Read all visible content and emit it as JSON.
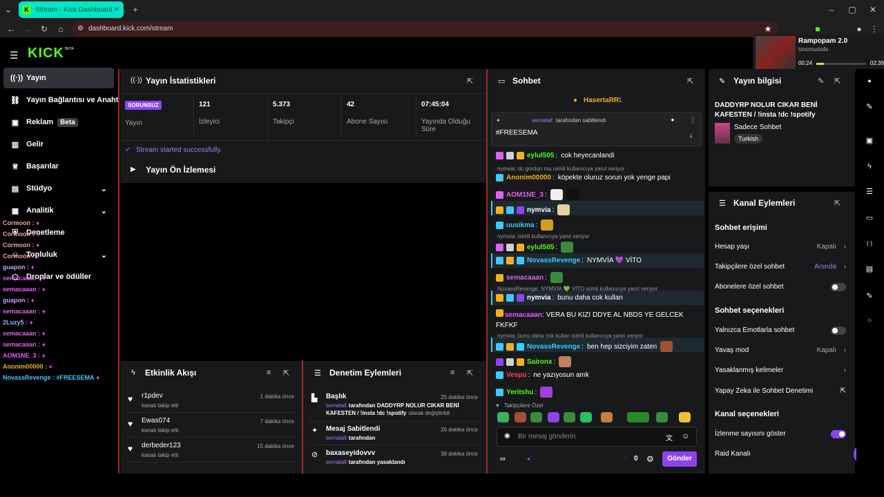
{
  "browser": {
    "tab_title": "Stream - Kick Dashboard",
    "url": "dashboard.kick.com/stream"
  },
  "media_popup": {
    "title": "Rampopam 2.0",
    "artist": "tzocmustafa",
    "time_elapsed": "00:24",
    "time_total": "02:39",
    "progress": 0.15
  },
  "sidebar": {
    "logo": "KICK",
    "logo_tag": "BETA",
    "items": [
      {
        "label": "Yayın",
        "icon": "broadcast-icon"
      },
      {
        "label": "Yayın Bağlantısı ve Anahtarı",
        "icon": "link-icon"
      },
      {
        "label": "Reklam",
        "icon": "ad-icon",
        "badge": "Beta"
      },
      {
        "label": "Gelir",
        "icon": "revenue-icon"
      },
      {
        "label": "Başarılar",
        "icon": "trophy-icon"
      },
      {
        "label": "Stüdyo",
        "icon": "studio-icon"
      },
      {
        "label": "Analitik",
        "icon": "analytics-icon"
      },
      {
        "label": "Denetleme",
        "icon": "moderation-icon"
      },
      {
        "label": "Topluluk",
        "icon": "community-icon"
      },
      {
        "label": "Droplar ve ödüller",
        "icon": "drops-icon"
      }
    ]
  },
  "overlay_chat": [
    {
      "user": "Cormoon :",
      "color": "#f3a0a0"
    },
    {
      "user": "Cormoon :",
      "color": "#f3a0a0"
    },
    {
      "user": "Cormoon :",
      "color": "#f3a0a0"
    },
    {
      "user": "Cormoon :",
      "color": "#f3a0a0"
    },
    {
      "user": "guapon :",
      "color": "#c9a0ff"
    },
    {
      "user": "semacaaan :",
      "color": "#e060f0"
    },
    {
      "user": "semacaaan :",
      "color": "#e060f0"
    },
    {
      "user": "guapon :",
      "color": "#c9a0ff"
    },
    {
      "user": "semacaaan :",
      "color": "#e060f0"
    },
    {
      "user": "2Luzy5 :",
      "color": "#9ab0ff"
    },
    {
      "user": "semacaaan :",
      "color": "#e060f0"
    },
    {
      "user": "semacaaan :",
      "color": "#e060f0"
    },
    {
      "user": "AOM1NE_3 :",
      "color": "#e060f0"
    },
    {
      "user": "Anonim00000 :",
      "color": "#f0b020"
    },
    {
      "user": "NovassRevenge : #FREESEMA",
      "color": "#40c8ff"
    }
  ],
  "stats": {
    "title": "Yayın İstatistikleri",
    "status_badge": "SORUNSUZ",
    "status_label": "Yayın",
    "items": [
      {
        "value": "121",
        "label": "İzleyici"
      },
      {
        "value": "5.373",
        "label": "Takipçi"
      },
      {
        "value": "42",
        "label": "Abone Sayısı"
      },
      {
        "value": "07:45:04",
        "label": "Yayında Olduğu Süre"
      }
    ],
    "success_message": "Stream started successfully."
  },
  "preview": {
    "title": "Yayın Ön İzlemesi"
  },
  "activity": {
    "title": "Etkinlik Akışı",
    "items": [
      {
        "user": "r1pdev",
        "action": "kanalı takip etti",
        "time": "1 dakika önce"
      },
      {
        "user": "Ewas074",
        "action": "kanalı takip etti",
        "time": "7 dakika önce"
      },
      {
        "user": "derbeder123",
        "action": "kanalı takip etti",
        "time": "15 dakika önce"
      }
    ]
  },
  "moderation": {
    "title": "Denetim Eylemleri",
    "items": [
      {
        "title": "Başlık",
        "time": "25 dakika önce",
        "actor": "sematall",
        "text": "tarafından DADDYRP NOLUR CIKAR BENİ KAFESTEN / !insta !dc !spotify",
        "suffix": "olarak değiştirildi"
      },
      {
        "title": "Mesaj Sabitlendi",
        "time": "26 dakika önce",
        "actor": "sematall",
        "text": "tarafından",
        "suffix": ""
      },
      {
        "title": "baxaseyidovvv",
        "time": "38 dakika önce",
        "actor": "sematall",
        "text": "tarafından yasaklandı",
        "suffix": ""
      }
    ]
  },
  "chat": {
    "title": "Sohbet",
    "top_gifter": "HasertaRR",
    "top_gifter_count": "1",
    "pinned_by": "sematall",
    "pinned_label": "tarafından sabitlendi",
    "pinned_message": "#FREESEMA",
    "messages": [
      {
        "reply": "",
        "user": "eylul505",
        "color": "#53fc18",
        "text": "cok heyecanlandi"
      },
      {
        "reply": "nymvia: dc gordun mu isimli kullanıcıya yanıt veriyor",
        "user": "Anonim00000",
        "color": "#f0b020",
        "text": "köpekte oluruz sorun yok yenge papi"
      },
      {
        "reply": "",
        "user": "AOM1NE_3",
        "color": "#e060f0",
        "text": ""
      },
      {
        "reply": "",
        "user": "nymvia",
        "color": "#ffffff",
        "text": ""
      },
      {
        "reply": "",
        "user": "uusikma",
        "color": "#40c8ff",
        "text": ""
      },
      {
        "reply": "nymvia: isimli kullanıcıya yanıt veriyor",
        "user": "eylul505",
        "color": "#53fc18",
        "text": ""
      },
      {
        "reply": "",
        "user": "NovassRevenge",
        "color": "#40c8ff",
        "text": "NYMVİA 💜 VİTO"
      },
      {
        "reply": "",
        "user": "semacaaan",
        "color": "#e060f0",
        "text": ""
      },
      {
        "reply": "NovassRevenge: NYMVİA 💚 VİTO isimli kullanıcıya yanıt veriyor",
        "user": "nymvia",
        "color": "#ffffff",
        "text": "bunu daha cok kullan"
      },
      {
        "reply": "",
        "user": "semacaaan",
        "color": "#e060f0",
        "text": "VERA BU KIZI DDYE AL NBDS YE GELCEK FKFKF"
      },
      {
        "reply": "nymvia: bunu daha cok kullan isimli kullanıcıya yanıt veriyor",
        "user": "NovassRevenge",
        "color": "#40c8ff",
        "text": "ben hep sizciyim zaten"
      },
      {
        "reply": "",
        "user": "Saironx",
        "color": "#53fc18",
        "text": ""
      },
      {
        "reply": "",
        "user": "Vespu",
        "color": "#ff4040",
        "text": "ne yazıyosun amk"
      },
      {
        "reply": "",
        "user": "Yeritshu",
        "color": "#53fc18",
        "text": ""
      }
    ],
    "followers_only_label": "Takipçilere Özel",
    "input_placeholder": "Bir mesaj gönderin",
    "points": "0",
    "send_label": "Gönder"
  },
  "stream_info": {
    "title": "Yayın bilgisi",
    "stream_title": "DADDYRP NOLUR CIKAR BENİ KAFESTEN / !insta !dc !spotify",
    "category": "Sadece Sohbet",
    "tag": "Turkish"
  },
  "channel_actions": {
    "title": "Kanal Eylemleri",
    "chat_access_heading": "Sohbet erişimi",
    "account_age_label": "Hesap yaşı",
    "account_age_value": "Kapalı",
    "followers_only_label": "Takipçilere özel sohbet",
    "followers_only_value": "Anında",
    "subs_only_label": "Abonelere özel sohbet",
    "chat_options_heading": "Sohbet seçenekleri",
    "emote_only_label": "Yalnızca Emotlarla sohbet",
    "slow_mode_label": "Yavaş mod",
    "slow_mode_value": "Kapalı",
    "banned_words_label": "Yasaklanmış kelimeler",
    "ai_moderation_label": "Yapay Zeka ile Sohbet Denetimi",
    "channel_options_heading": "Kanal seçenekleri",
    "show_viewers_label": "İzlenme sayısını göster",
    "raid_label": "Raid Kanalı"
  }
}
